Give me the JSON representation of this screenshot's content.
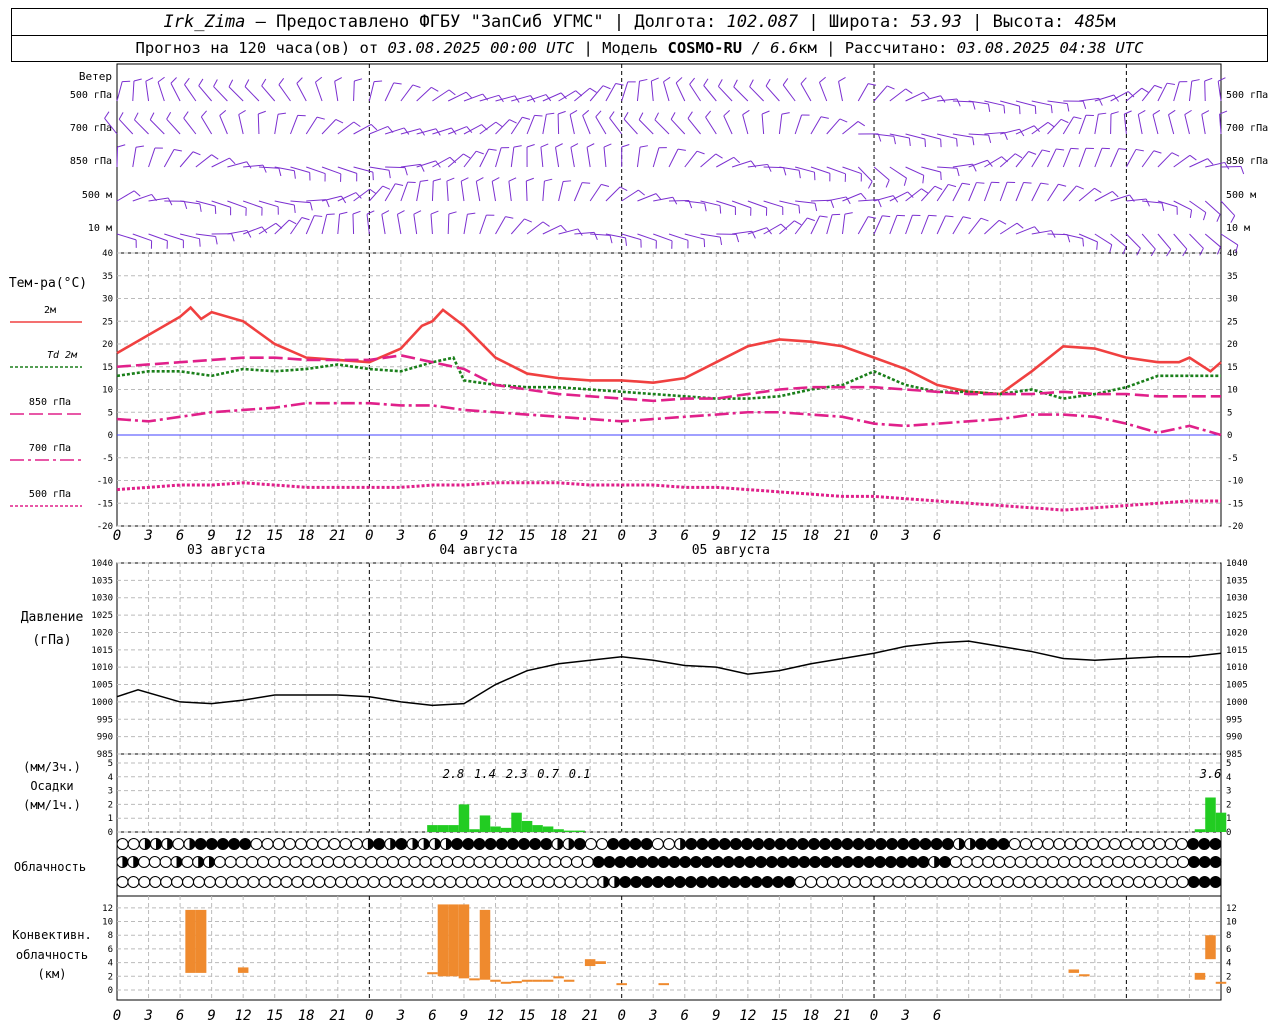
{
  "header": {
    "station": "Irk_Zima",
    "sep1": " – Предоставлено ФГБУ \"ЗапСиб УГМС\" | Долгота: ",
    "lon": "102.087",
    "sep2": " | Широта: ",
    "lat": "53.93",
    "sep3": " | Высота: ",
    "alt": "485",
    "alt_unit": "м",
    "forecast_prefix": "Прогноз на 120 часа(ов) от ",
    "start": "03.08.2025 00:00 UTC",
    "model_prefix": "  | Модель ",
    "model": "COSMO-RU",
    "model_res": " / 6.6",
    "res_unit": "км",
    "calc_prefix": " | Рассчитано: ",
    "calc": "03.08.2025 04:38 UTC"
  },
  "colors": {
    "wind": "#7b2fd0",
    "t2m": "#f04040",
    "td2m": "#1a7f1a",
    "t850": "#e0208a",
    "t700": "#e0208a",
    "t500": "#e0208a",
    "precip": "#22cc22",
    "conv": "#ef8a2e",
    "pressure": "#000000",
    "zero_line": "#4040ff"
  },
  "labels": {
    "wind_title": "Ветер",
    "wind_levels": [
      "500 гПа",
      "700 гПа",
      "850 гПа",
      "500 м",
      "10  м"
    ],
    "temp_title": "Тем-ра(°С)",
    "temp_legend": [
      "2м",
      "Td  2м",
      "850 гПа",
      "700 гПа",
      "500 гПа"
    ],
    "pressure_title": "Давление",
    "pressure_unit": "(гПа)",
    "precip_unit1": "(мм/3ч.)",
    "precip_title": "Осадки",
    "precip_unit2": "(мм/1ч.)",
    "cloud_title": "Облачность",
    "conv_title1": "Конвективн.",
    "conv_title2": "облачность",
    "conv_unit": "(км)",
    "days": [
      "03 августа",
      "04 августа",
      "05 августа"
    ]
  },
  "chart_data": {
    "type": "line",
    "hours": [
      0,
      3,
      6,
      9,
      12,
      15,
      18,
      21,
      0,
      3,
      6,
      9,
      12,
      15,
      18,
      21,
      0,
      3,
      6,
      9,
      12,
      15,
      18,
      21,
      0,
      3,
      6
    ],
    "temperature": {
      "ylim": [
        -20,
        40
      ],
      "ticks": [
        40,
        35,
        30,
        25,
        20,
        15,
        10,
        5,
        0,
        -5,
        -10,
        -15,
        -20
      ],
      "series": [
        {
          "name": "2м",
          "style": "solid",
          "x": [
            0,
            6,
            7,
            8,
            9,
            12,
            15,
            18,
            21,
            24,
            27,
            29,
            30,
            31,
            33,
            36,
            39,
            42,
            45,
            48,
            51,
            54,
            57,
            60,
            63,
            66,
            69,
            72,
            75,
            78,
            81,
            84,
            87,
            90,
            93,
            96,
            99,
            101,
            102,
            104,
            105
          ],
          "y": [
            18,
            26,
            28,
            25.5,
            27,
            25,
            20,
            17,
            16.5,
            16,
            19,
            24,
            25,
            27.5,
            24,
            17,
            13.5,
            12.5,
            12,
            12,
            11.5,
            12.5,
            16,
            19.5,
            21,
            20.5,
            19.5,
            17,
            14.5,
            11,
            9.5,
            9,
            14,
            19.5,
            19,
            17,
            16,
            16,
            17,
            14,
            16
          ]
        },
        {
          "name": "Td  2м",
          "style": "dotted",
          "x": [
            0,
            3,
            6,
            9,
            12,
            15,
            18,
            21,
            24,
            27,
            30,
            32,
            33,
            36,
            39,
            42,
            45,
            48,
            51,
            54,
            57,
            60,
            63,
            66,
            69,
            72,
            75,
            78,
            81,
            84,
            87,
            90,
            93,
            96,
            99,
            102,
            105
          ],
          "y": [
            13,
            14,
            14,
            13,
            14.5,
            14,
            14.5,
            15.5,
            14.5,
            14,
            16,
            17,
            12,
            11,
            10.5,
            10.5,
            10,
            9.5,
            9,
            8.5,
            8,
            8,
            8.5,
            10,
            11,
            14,
            11,
            9.5,
            9.5,
            9,
            10,
            8,
            9,
            10.5,
            13,
            13,
            13
          ]
        },
        {
          "name": "850 гПа",
          "style": "dash",
          "x": [
            0,
            3,
            6,
            9,
            12,
            15,
            18,
            21,
            24,
            27,
            30,
            33,
            36,
            39,
            42,
            45,
            48,
            51,
            54,
            57,
            60,
            63,
            66,
            69,
            72,
            75,
            78,
            81,
            84,
            87,
            90,
            93,
            96,
            99,
            102,
            105
          ],
          "y": [
            15,
            15.5,
            16,
            16.5,
            17,
            17,
            16.5,
            16.5,
            16.5,
            17.5,
            16,
            14.5,
            11,
            10,
            9,
            8.5,
            8,
            7.5,
            8,
            8,
            9,
            10,
            10.5,
            10.5,
            10.5,
            10,
            9.5,
            9,
            9,
            9,
            9.5,
            9,
            9,
            8.5,
            8.5,
            8.5
          ]
        },
        {
          "name": "700 гПа",
          "style": "dashdot",
          "x": [
            0,
            3,
            6,
            9,
            12,
            15,
            18,
            21,
            24,
            27,
            30,
            33,
            36,
            39,
            42,
            45,
            48,
            51,
            54,
            57,
            60,
            63,
            66,
            69,
            72,
            75,
            78,
            81,
            84,
            87,
            90,
            93,
            96,
            99,
            102,
            105
          ],
          "y": [
            3.5,
            3,
            4,
            5,
            5.5,
            6,
            7,
            7,
            7,
            6.5,
            6.5,
            5.5,
            5,
            4.5,
            4,
            3.5,
            3,
            3.5,
            4,
            4.5,
            5,
            5,
            4.5,
            4,
            2.5,
            2,
            2.5,
            3,
            3.5,
            4.5,
            4.5,
            4,
            2.5,
            0.5,
            2,
            0
          ]
        },
        {
          "name": "500 гПа",
          "style": "dotted",
          "x": [
            0,
            3,
            6,
            9,
            12,
            15,
            18,
            21,
            24,
            27,
            30,
            33,
            36,
            39,
            42,
            45,
            48,
            51,
            54,
            57,
            60,
            63,
            66,
            69,
            72,
            75,
            78,
            81,
            84,
            87,
            90,
            93,
            96,
            99,
            102,
            105
          ],
          "y": [
            -12,
            -11.5,
            -11,
            -11,
            -10.5,
            -11,
            -11.5,
            -11.5,
            -11.5,
            -11.5,
            -11,
            -11,
            -10.5,
            -10.5,
            -10.5,
            -11,
            -11,
            -11,
            -11.5,
            -11.5,
            -12,
            -12.5,
            -13,
            -13.5,
            -13.5,
            -14,
            -14.5,
            -15,
            -15.5,
            -16,
            -16.5,
            -16,
            -15.5,
            -15,
            -14.5,
            -14.5
          ]
        }
      ]
    },
    "pressure": {
      "ylim": [
        985,
        1040
      ],
      "ticks": [
        1040,
        1035,
        1030,
        1025,
        1020,
        1015,
        1010,
        1005,
        1000,
        995,
        990,
        985
      ],
      "x": [
        0,
        2,
        6,
        9,
        12,
        15,
        18,
        21,
        24,
        27,
        30,
        33,
        36,
        39,
        42,
        45,
        48,
        51,
        54,
        57,
        60,
        63,
        66,
        69,
        72,
        75,
        78,
        81,
        84,
        87,
        90,
        93,
        96,
        99,
        102,
        105
      ],
      "y": [
        1001.5,
        1003.5,
        1000,
        999.5,
        1000.5,
        1002,
        1002,
        1002,
        1001.5,
        1000,
        999,
        999.5,
        1005,
        1009,
        1011,
        1012,
        1013,
        1012,
        1010.5,
        1010,
        1008,
        1009,
        1011,
        1012.5,
        1014,
        1016,
        1017,
        1017.5,
        1016,
        1014.5,
        1012.5,
        1012,
        1012.5,
        1013,
        1013,
        1014
      ]
    },
    "precipitation": {
      "ylim": [
        0,
        5
      ],
      "ticks": [
        5,
        4,
        3,
        2,
        1,
        0
      ],
      "bars_1h": [
        [
          30,
          0.5
        ],
        [
          31,
          0.5
        ],
        [
          32,
          0.5
        ],
        [
          33,
          2.0
        ],
        [
          34,
          0.2
        ],
        [
          35,
          1.2
        ],
        [
          36,
          0.4
        ],
        [
          37,
          0.3
        ],
        [
          38,
          1.4
        ],
        [
          39,
          0.8
        ],
        [
          40,
          0.5
        ],
        [
          41,
          0.4
        ],
        [
          42,
          0.2
        ],
        [
          43,
          0.1
        ],
        [
          44,
          0.1
        ],
        [
          103,
          0.2
        ],
        [
          104,
          2.5
        ],
        [
          105,
          1.4
        ]
      ],
      "totals_3h": [
        {
          "x": 32,
          "v": "2.8"
        },
        {
          "x": 35,
          "v": "1.4"
        },
        {
          "x": 38,
          "v": "2.3"
        },
        {
          "x": 41,
          "v": "0.7"
        },
        {
          "x": 44,
          "v": "0.1"
        },
        {
          "x": 104,
          "v": "3.6"
        }
      ]
    },
    "cloud": {
      "rows": [
        "eehhhehfffffeeeeeeeeeehfhfhhhhfffffffffhhfeeffffeehffffffffffffffffffffffffhhfffeeeeeeeeeeeeeeeefff",
        "hheeehehheeeeeeeeeeeeeeeeeeeeeeeeeeeeeeeeeeefffffffffffffffffffffffffffffffhfeeeeeeeeeeeeeeeeeeeeeefff",
        "eeeeeeeeeeeeeeeeeeeeeeeeeeeeeeeeeeeeeeeeeeeehhffffffffffffffffeeeeeeeeeeeeeeeeeeeeeeeeeeeeeeeeeeeefff"
      ]
    },
    "convective": {
      "ylim": [
        0,
        13
      ],
      "ticks": [
        12,
        10,
        8,
        6,
        4,
        2,
        0
      ],
      "bars": [
        [
          7,
          2.5,
          11.7
        ],
        [
          8,
          2.5,
          11.7
        ],
        [
          12,
          2.5,
          3.3
        ],
        [
          30,
          2.3,
          2.6
        ],
        [
          31,
          2,
          12.5
        ],
        [
          32,
          2,
          12.5
        ],
        [
          33,
          1.7,
          12.5
        ],
        [
          34,
          1.5,
          1.7
        ],
        [
          35,
          1.5,
          11.7
        ],
        [
          36,
          1.2,
          1.5
        ],
        [
          37,
          1.0,
          1.2
        ],
        [
          38,
          1.0,
          1.3
        ],
        [
          39,
          1.2,
          1.5
        ],
        [
          40,
          1.2,
          1.5
        ],
        [
          41,
          1.2,
          1.5
        ],
        [
          42,
          1.7,
          2.0
        ],
        [
          43,
          1.2,
          1.5
        ],
        [
          45,
          3.5,
          4.5
        ],
        [
          46,
          3.8,
          4.2
        ],
        [
          48,
          0.8,
          1.0
        ],
        [
          52,
          0.8,
          1.0
        ],
        [
          105,
          1.0,
          1.2
        ],
        [
          91,
          3.0,
          2.5
        ],
        [
          92,
          2.0,
          2.3
        ],
        [
          103,
          1.5,
          2.5
        ],
        [
          104,
          4.5,
          8.0
        ]
      ]
    }
  }
}
